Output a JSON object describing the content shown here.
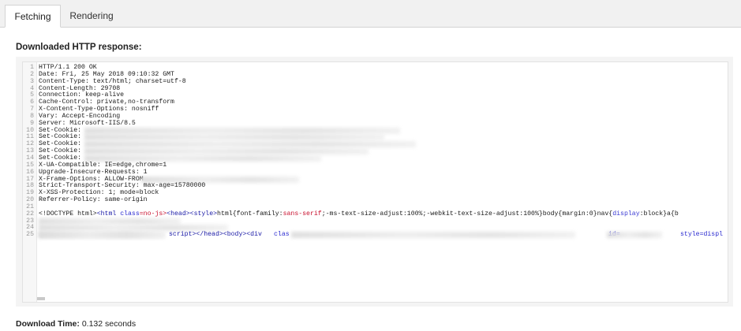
{
  "tabs": [
    {
      "label": "Fetching",
      "active": true
    },
    {
      "label": "Rendering",
      "active": false
    }
  ],
  "section_title": "Downloaded HTTP response:",
  "response_lines": [
    "HTTP/1.1 200 OK",
    "Date: Fri, 25 May 2018 09:10:32 GMT",
    "Content-Type: text/html; charset=utf-8",
    "Content-Length: 29708",
    "Connection: keep-alive",
    "Cache-Control: private,no-transform",
    "X-Content-Type-Options: nosniff",
    "Vary: Accept-Encoding",
    "Server: Microsoft-IIS/8.5",
    "Set-Cookie:",
    "Set-Cookie:",
    "Set-Cookie:",
    "Set-Cookie:",
    "Set-Cookie:",
    "X-UA-Compatible: IE=edge,chrome=1",
    "Upgrade-Insecure-Requests: 1",
    "X-Frame-Options: ALLOW-FROM",
    "Strict-Transport-Security: max-age=15780000",
    "X-XSS-Protection: 1; mode=block",
    "Referrer-Policy: same-origin",
    "",
    "",
    "",
    "",
    ""
  ],
  "line22": {
    "p1": "<!DOCTYPE html>",
    "p2": "<html ",
    "p3": "class",
    "p4": "=no-js>",
    "p5": "<head><style>",
    "p6": "html{font-family:",
    "p7": "sans-serif",
    "p8": ";-ms-text-size-adjust:100%;-webkit-text-size-adjust:100%}body{margin:0}nav{",
    "p9": "display",
    "p10": ":block}a{b"
  },
  "line25": {
    "p1": "script></head><body><div ",
    "p2": "clas",
    "p3": "id=",
    "p4": "style=displ"
  },
  "footer": {
    "label": "Download Time:",
    "value": " 0.132 seconds"
  }
}
